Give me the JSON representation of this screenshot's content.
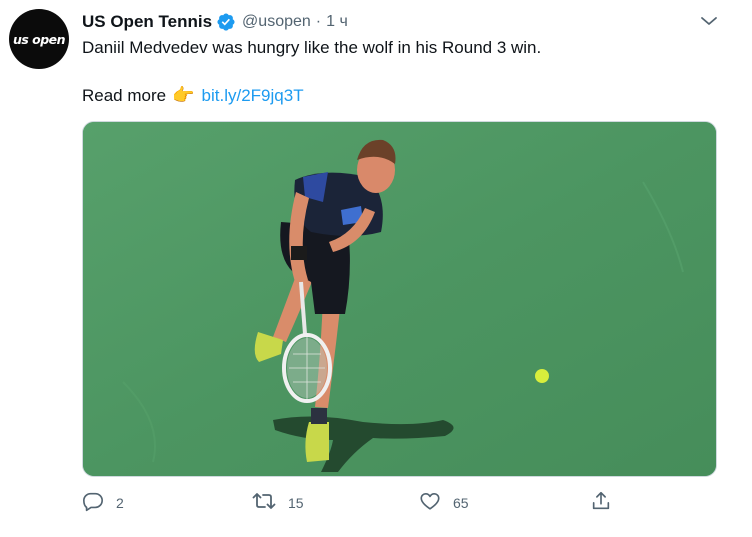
{
  "tweet": {
    "author": {
      "avatar_text": "us open",
      "display_name": "US Open Tennis",
      "verified_icon": "verified-badge-icon",
      "handle": "@usopen",
      "separator": "·",
      "time": "1 ч"
    },
    "more_icon": "chevron-down-icon",
    "text_line1": "Daniil Medvedev was hungry like the wolf in his Round 3 win.",
    "text_line2_prefix": "Read more",
    "emoji": "👉",
    "link": "bit.ly/2F9jq3T",
    "media": {
      "description": "photo-tennis-player-serving"
    },
    "actions": {
      "reply": {
        "icon": "reply-icon",
        "count": "2"
      },
      "retweet": {
        "icon": "retweet-icon",
        "count": "15"
      },
      "like": {
        "icon": "heart-icon",
        "count": "65"
      },
      "share": {
        "icon": "share-icon"
      }
    },
    "colors": {
      "link": "#1d9bf0",
      "verified": "#1d9bf0",
      "secondary_text": "#536471",
      "court_green": "#4d9863"
    }
  }
}
